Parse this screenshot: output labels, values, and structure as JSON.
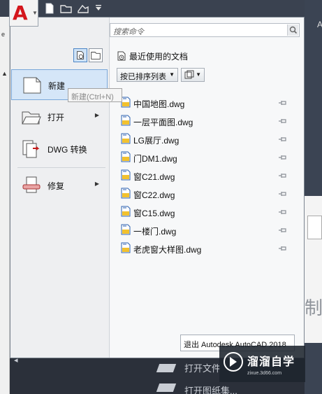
{
  "app": {
    "logo_letter": "A",
    "quick_access": [
      "new-icon",
      "open-icon",
      "save-icon",
      "dropdown-icon"
    ]
  },
  "menu": {
    "search_placeholder": "搜索命令",
    "left_items": [
      {
        "id": "new",
        "label": "新建",
        "active": true
      },
      {
        "id": "open",
        "label": "打开",
        "has_submenu": true
      },
      {
        "id": "dwg-convert",
        "label": "DWG 转换"
      },
      {
        "id": "repair",
        "label": "修复",
        "has_submenu": true
      }
    ],
    "tooltip": "新建(Ctrl+N)",
    "recent": {
      "heading": "最近使用的文档",
      "sort_label": "按已排序列表",
      "files": [
        "中国地图.dwg",
        "一层平面图.dwg",
        "LG展厅.dwg",
        "门DM1.dwg",
        "窗C21.dwg",
        "窗C22.dwg",
        "窗C15.dwg",
        "一楼门.dwg",
        "老虎窗大样图.dwg"
      ]
    },
    "exit_label": "退出 Autodesk AutoCAD 2018"
  },
  "background": {
    "bottom_items": [
      "打开文件",
      "打开图纸集..."
    ],
    "right_letter": "A",
    "right_char": "制"
  },
  "watermark": {
    "brand": "溜溜自学",
    "url": "zixue.3d66.com"
  },
  "colors": {
    "logo": "#d4161c",
    "active_item": "#d5e6f8",
    "chrome_dark": "#3a4250"
  }
}
